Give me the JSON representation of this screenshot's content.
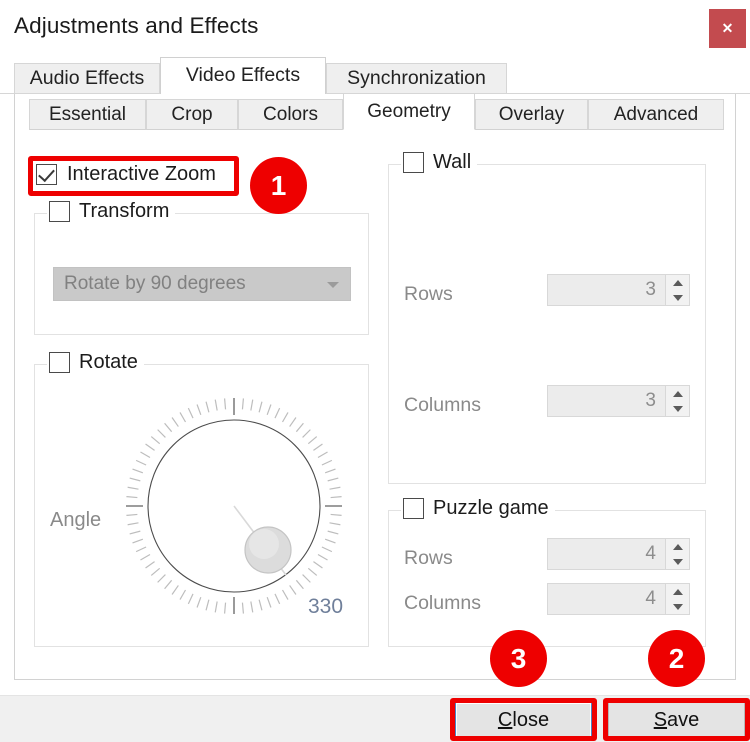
{
  "window": {
    "title": "Adjustments and Effects",
    "close_glyph": "✕"
  },
  "tabs": [
    {
      "label": "Audio Effects",
      "active": false
    },
    {
      "label": "Video Effects",
      "active": true
    },
    {
      "label": "Synchronization",
      "active": false
    }
  ],
  "subtabs": [
    {
      "label": "Essential",
      "active": false
    },
    {
      "label": "Crop",
      "active": false
    },
    {
      "label": "Colors",
      "active": false
    },
    {
      "label": "Geometry",
      "active": true
    },
    {
      "label": "Overlay",
      "active": false
    },
    {
      "label": "Advanced",
      "active": false
    }
  ],
  "geometry": {
    "interactive_zoom": {
      "label": "Interactive Zoom",
      "checked": true
    },
    "transform": {
      "label": "Transform",
      "checked": false,
      "mode_value": "Rotate by 90 degrees"
    },
    "rotate": {
      "label": "Rotate",
      "checked": false,
      "angle_label": "Angle",
      "angle_value": "330"
    },
    "wall": {
      "label": "Wall",
      "checked": false,
      "rows_label": "Rows",
      "rows_value": "3",
      "columns_label": "Columns",
      "columns_value": "3"
    },
    "puzzle": {
      "label": "Puzzle game",
      "checked": false,
      "rows_label": "Rows",
      "rows_value": "4",
      "columns_label": "Columns",
      "columns_value": "4"
    }
  },
  "buttons": {
    "close": {
      "label": "Close",
      "mnemonic": "C",
      "rest": "lose"
    },
    "save": {
      "label": "Save",
      "mnemonic": "S",
      "rest": "ave"
    }
  },
  "annotations": {
    "step1": "1",
    "step2": "2",
    "step3": "3",
    "highlight_color": "#ee0000"
  }
}
